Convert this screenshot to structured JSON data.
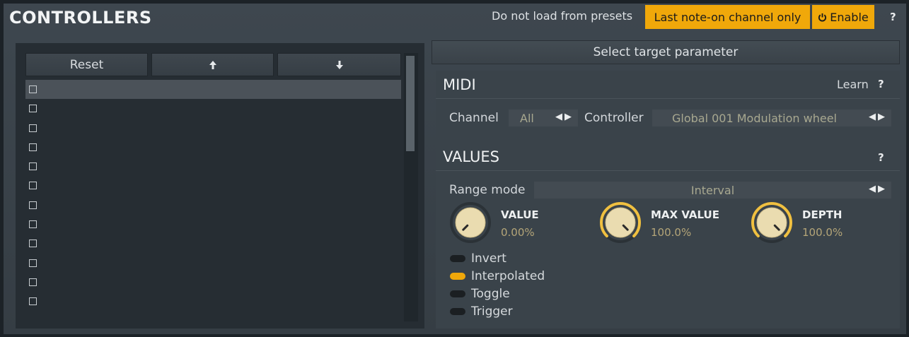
{
  "header": {
    "title": "CONTROLLERS",
    "no_presets_label": "Do not load from presets",
    "last_note_label": "Last note-on channel only",
    "enable_label": "Enable",
    "help": "?"
  },
  "list": {
    "reset_label": "Reset",
    "up_label": "🠕",
    "down_label": "🠗",
    "rows": 12,
    "selected_index": 0
  },
  "right": {
    "select_target_label": "Select target parameter"
  },
  "midi": {
    "title": "MIDI",
    "learn_label": "Learn",
    "help": "?",
    "channel_label": "Channel",
    "channel_value": "All",
    "controller_label": "Controller",
    "controller_value": "Global 001 Modulation wheel",
    "arrows": "◀▶"
  },
  "values": {
    "title": "VALUES",
    "help": "?",
    "range_mode_label": "Range mode",
    "range_mode_value": "Interval",
    "arrows": "◀▶",
    "knobs": {
      "value": {
        "label": "VALUE",
        "display": "0.00%",
        "level": 0.0
      },
      "max_value": {
        "label": "MAX VALUE",
        "display": "100.0%",
        "level": 1.0
      },
      "depth": {
        "label": "DEPTH",
        "display": "100.0%",
        "level": 1.0
      }
    },
    "toggles": {
      "invert": {
        "label": "Invert",
        "on": false
      },
      "interpolated": {
        "label": "Interpolated",
        "on": true
      },
      "toggle": {
        "label": "Toggle",
        "on": false
      },
      "trigger": {
        "label": "Trigger",
        "on": false
      }
    }
  },
  "colors": {
    "accent": "#f0a80a",
    "value_text": "#b4a578",
    "panel": "#3a434a"
  }
}
